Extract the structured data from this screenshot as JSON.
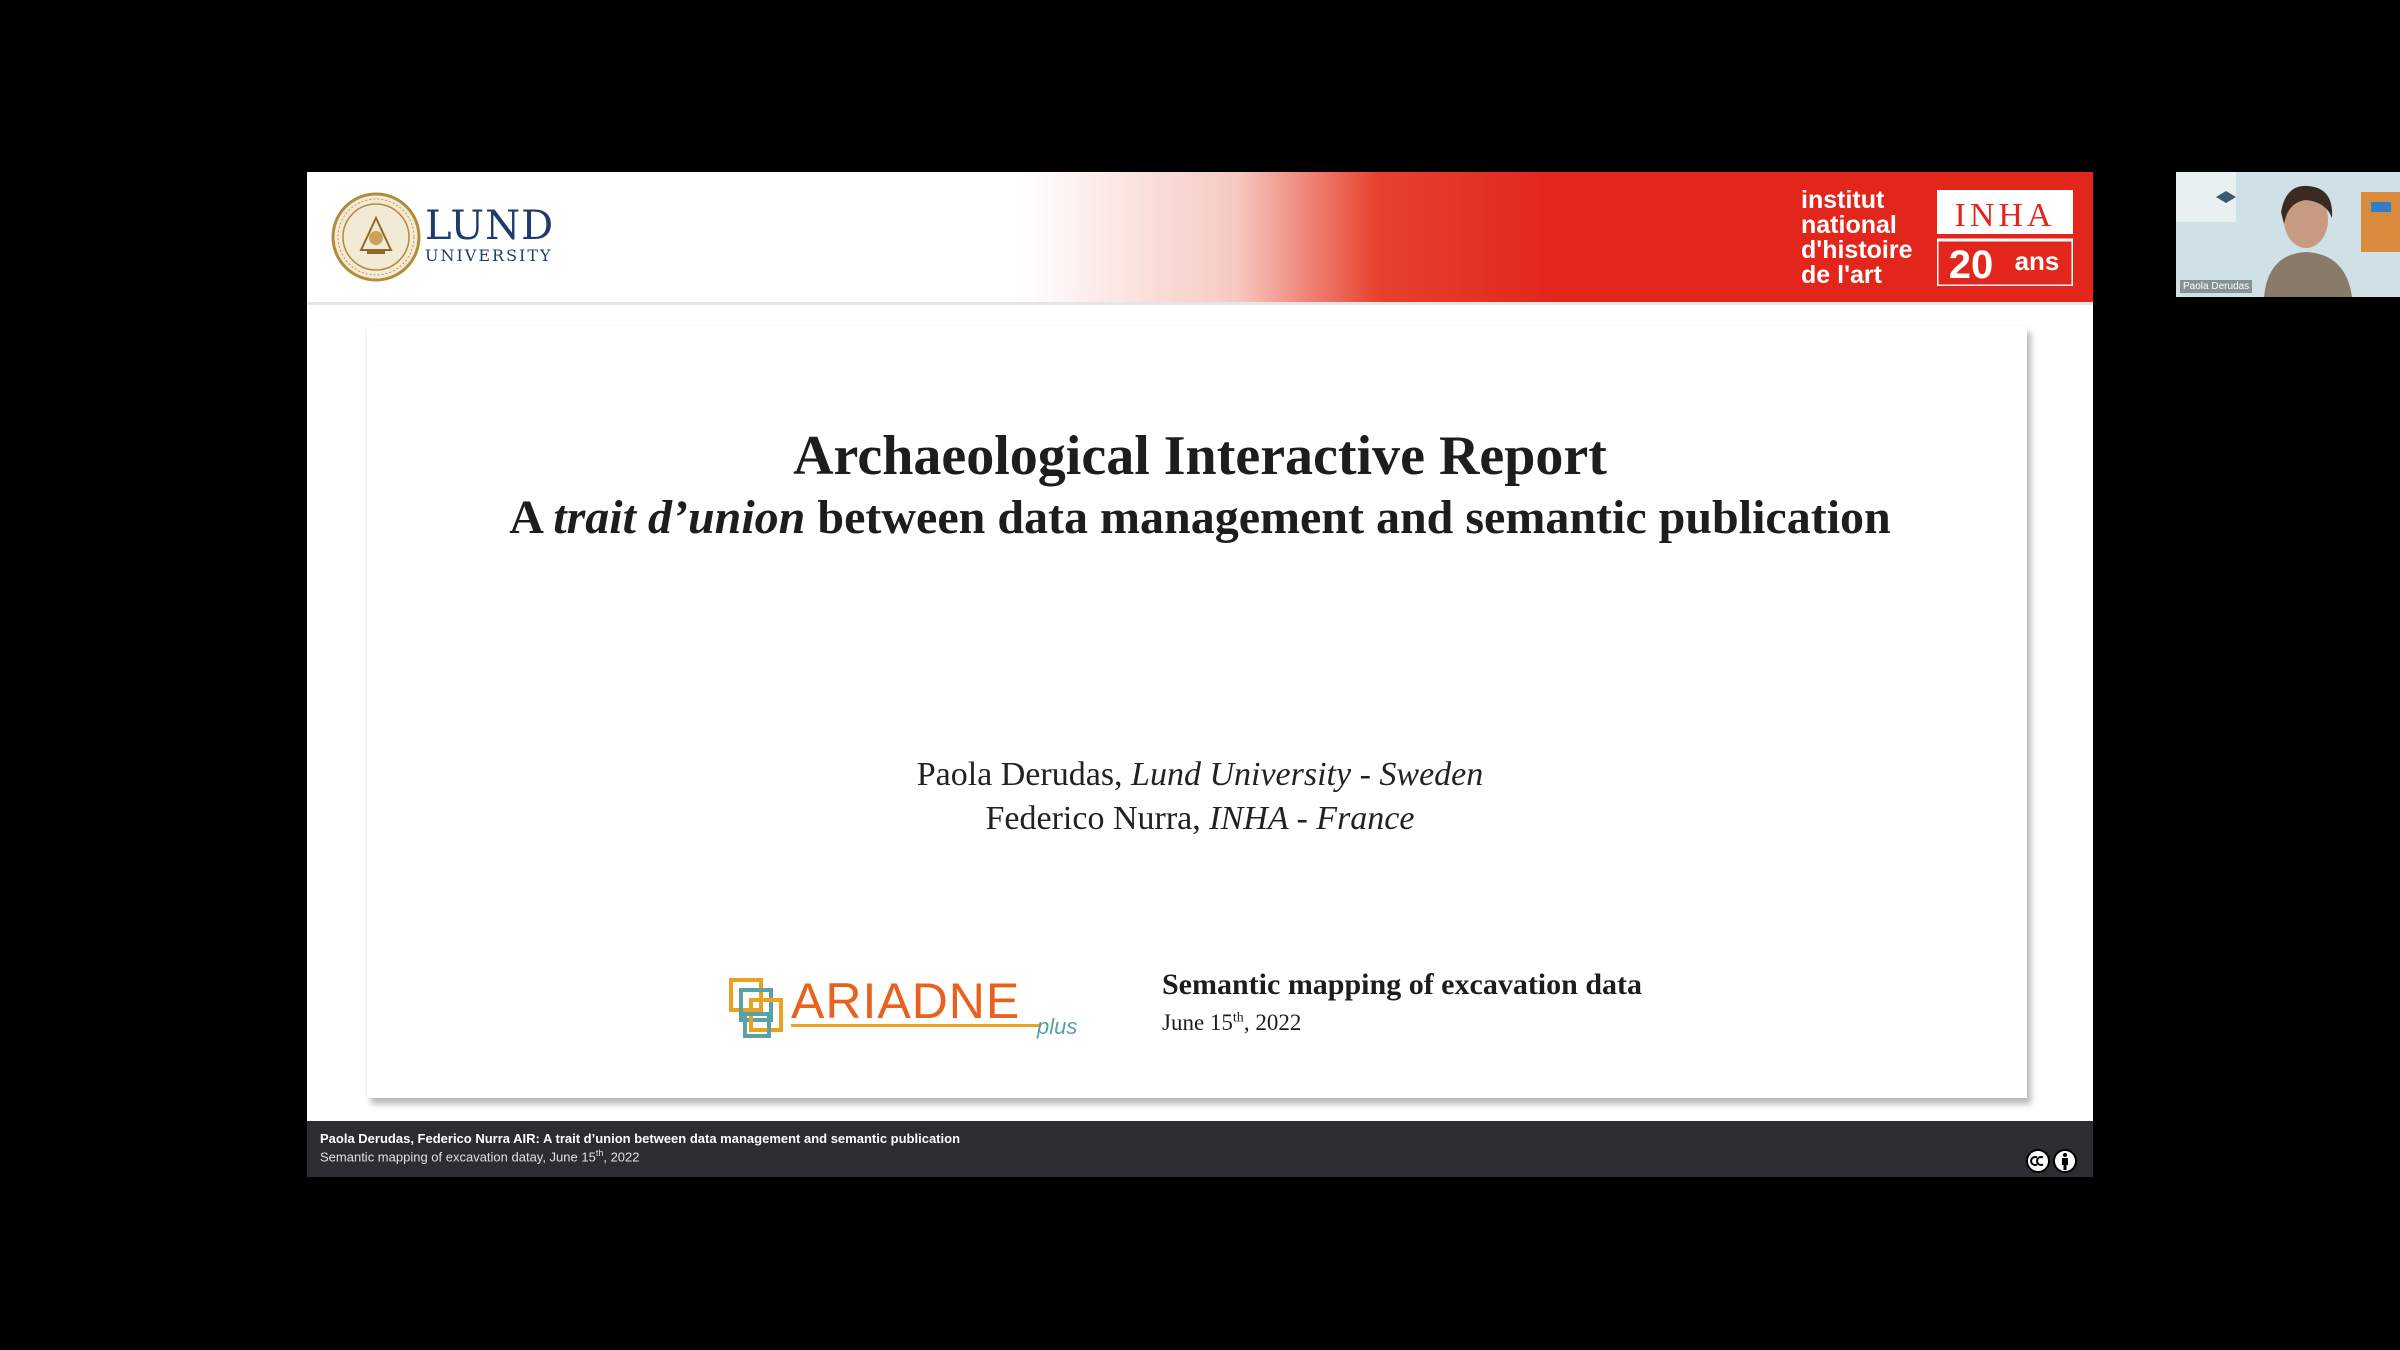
{
  "header": {
    "lund_name": "LUND",
    "lund_sub": "UNIVERSITY",
    "inha_lines": [
      "institut",
      "national",
      "d'histoire",
      "de l'art"
    ],
    "inha_mark": "INHA",
    "inha_anniv_num": "20",
    "inha_anniv_word": "ans"
  },
  "slide": {
    "title": "Archaeological Interactive Report",
    "subtitle_pre": "A ",
    "subtitle_italic": "trait d’union",
    "subtitle_post": " between data management and semantic publication",
    "authors": [
      {
        "name": "Paola Derudas,",
        "affiliation": "Lund University - Sweden"
      },
      {
        "name": "Federico Nurra,",
        "affiliation": "INHA - France"
      }
    ],
    "ariadne_main": "ARIADNE",
    "ariadne_plus": "plus",
    "conference_title": "Semantic mapping of excavation data",
    "date_pre": "June 15",
    "date_sup": "th",
    "date_post": ", 2022"
  },
  "footer": {
    "line1": "Paola Derudas, Federico Nurra  AIR: A trait d’union between data management and semantic publication",
    "line2_pre": "Semantic mapping of excavation datay, June 15",
    "line2_sup": "th",
    "line2_post": ", 2022"
  },
  "video": {
    "participant_name": "Paola Derudas"
  },
  "colors": {
    "inha_red": "#e2261c",
    "lund_blue": "#1f3b6b",
    "lund_gold": "#b48a3c",
    "ariadne_orange": "#e8621f",
    "footer_bg": "#2b2d30"
  }
}
